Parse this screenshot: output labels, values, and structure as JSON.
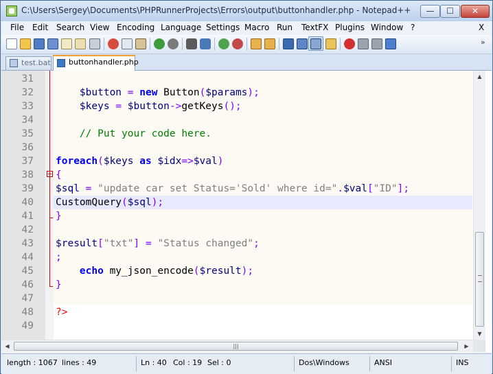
{
  "window": {
    "title": "C:\\Users\\Sergey\\Documents\\PHPRunnerProjects\\Errors\\output\\buttonhandler.php - Notepad++",
    "min_label": "—",
    "max_label": "☐",
    "close_label": "✕"
  },
  "menu": {
    "items": [
      "File",
      "Edit",
      "Search",
      "View",
      "Encoding",
      "Language",
      "Settings",
      "Macro",
      "Run",
      "TextFX",
      "Plugins",
      "Window",
      "?"
    ],
    "close_x": "X"
  },
  "toolbar": {
    "icons": [
      "new-file-icon",
      "open-file-icon",
      "save-icon",
      "save-all-icon",
      "close-icon",
      "close-all-icon",
      "print-icon",
      "cut-icon",
      "copy-icon",
      "paste-icon",
      "undo-icon",
      "redo-icon",
      "find-icon",
      "replace-icon",
      "zoom-in-icon",
      "zoom-out-icon",
      "sync-vertical-icon",
      "sync-horizontal-icon",
      "word-wrap-icon",
      "show-all-chars-icon",
      "indent-guide-icon",
      "user-lang-icon",
      "record-macro-icon",
      "stop-record-icon",
      "play-macro-icon",
      "run-macro-multiple-icon"
    ],
    "more": "»"
  },
  "tabs": [
    {
      "label": "test.bat",
      "active": false
    },
    {
      "label": "buttonhandler.php",
      "active": true
    }
  ],
  "editor": {
    "current_line": 40,
    "lines": [
      {
        "n": "31",
        "text": ""
      },
      {
        "n": "32",
        "text": "    $button = new Button($params);"
      },
      {
        "n": "33",
        "text": "    $keys = $button->getKeys();"
      },
      {
        "n": "34",
        "text": ""
      },
      {
        "n": "35",
        "text": "    // Put your code here."
      },
      {
        "n": "36",
        "text": ""
      },
      {
        "n": "37",
        "text": "foreach($keys as $idx=>$val)"
      },
      {
        "n": "38",
        "text": "{"
      },
      {
        "n": "39",
        "text": "$sql = \"update car set Status='Sold' where id=\".$val[\"ID\"];"
      },
      {
        "n": "40",
        "text": "CustomQuery($sql);"
      },
      {
        "n": "41",
        "text": "}"
      },
      {
        "n": "42",
        "text": ""
      },
      {
        "n": "43",
        "text": "$result[\"txt\"] = \"Status changed\";"
      },
      {
        "n": "44",
        "text": ";"
      },
      {
        "n": "45",
        "text": "    echo my_json_encode($result);"
      },
      {
        "n": "46",
        "text": "}"
      },
      {
        "n": "47",
        "text": ""
      },
      {
        "n": "48",
        "text": "?>"
      },
      {
        "n": "49",
        "text": ""
      }
    ]
  },
  "scrollbars": {
    "up_arrow": "▲",
    "down_arrow": "▼",
    "left_arrow": "◀",
    "right_arrow": "▶",
    "h_grip": "|||"
  },
  "status": {
    "length": "length : 1067",
    "lines": "lines : 49",
    "ln": "Ln : 40",
    "col": "Col : 19",
    "sel": "Sel : 0",
    "eol": "Dos\\Windows",
    "encoding": "ANSI",
    "mode": "INS"
  },
  "colors": {
    "keyword": "#0000ff",
    "variable": "#000080",
    "operator": "#8000ff",
    "string": "#808080",
    "comment": "#008000",
    "php_tag": "#ff0000",
    "current_line": "#e8e8ff",
    "tab_accent": "#f79e2d"
  }
}
